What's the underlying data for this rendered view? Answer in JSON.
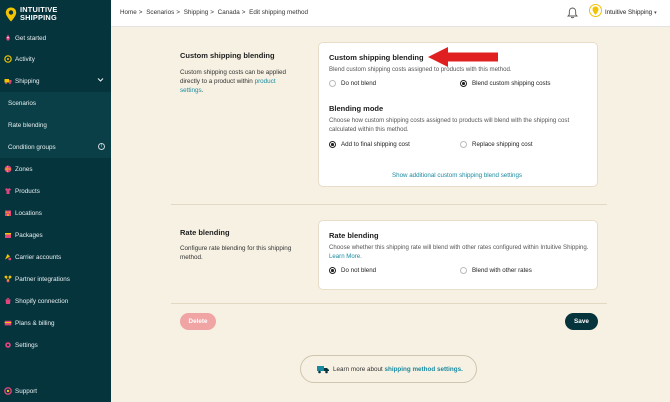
{
  "app": {
    "brand_line1": "INTUITIVE",
    "brand_line2": "SHIPPING"
  },
  "sidebar": {
    "items": [
      {
        "label": "Get started",
        "icon": "rocket-icon"
      },
      {
        "label": "Activity",
        "icon": "activity-icon"
      },
      {
        "label": "Shipping",
        "icon": "truck-icon"
      },
      {
        "label": "Scenarios"
      },
      {
        "label": "Rate blending"
      },
      {
        "label": "Condition groups"
      },
      {
        "label": "Zones",
        "icon": "globe-icon"
      },
      {
        "label": "Products",
        "icon": "shirt-icon"
      },
      {
        "label": "Locations",
        "icon": "building-icon"
      },
      {
        "label": "Packages",
        "icon": "box-icon"
      },
      {
        "label": "Carrier accounts",
        "icon": "carrier-icon"
      },
      {
        "label": "Partner integrations",
        "icon": "integration-icon"
      },
      {
        "label": "Shopify connection",
        "icon": "shopify-icon"
      },
      {
        "label": "Plans & billing",
        "icon": "billing-icon"
      },
      {
        "label": "Settings",
        "icon": "gear-icon"
      }
    ],
    "support": "Support"
  },
  "header": {
    "breadcrumbs": [
      "Home",
      "Scenarios",
      "Shipping",
      "Canada",
      "Edit shipping method"
    ],
    "separator": ">",
    "account_name": "Intuitive Shipping"
  },
  "custom_blending": {
    "section_title": "Custom shipping blending",
    "section_desc": "Custom shipping costs can be applied directly to a product within",
    "section_link": "product settings",
    "card_title": "Custom shipping blending",
    "card_desc": "Blend custom shipping costs assigned to products with this method.",
    "option_no": "Do not blend",
    "option_yes": "Blend custom shipping costs",
    "selected": "Blend custom shipping costs",
    "mode_title": "Blending mode",
    "mode_desc": "Choose how custom shipping costs assigned to products will blend with the shipping cost calculated within this method.",
    "mode_add": "Add to final shipping cost",
    "mode_replace": "Replace shipping cost",
    "mode_selected": "Add to final shipping cost",
    "show_more": "Show additional custom shipping blend settings"
  },
  "rate_blending": {
    "section_title": "Rate blending",
    "section_desc": "Configure rate blending for this shipping method.",
    "card_title": "Rate blending",
    "card_desc": "Choose whether this shipping rate will blend with other rates configured within Intuitive Shipping.",
    "card_link": "Learn More.",
    "option_no": "Do not blend",
    "option_yes": "Blend with other rates",
    "selected": "Do not blend"
  },
  "actions": {
    "delete": "Delete",
    "save": "Save"
  },
  "learn_more": {
    "text": "Learn more about",
    "link": "shipping method settings."
  },
  "colors": {
    "sidebar": "#06343d",
    "accent": "#1a8aa0",
    "background": "#f7f1e3",
    "delete": "#f0a4a4",
    "arrow": "#e02020",
    "logo_yellow": "#f2c300",
    "logo_pink": "#e0457b"
  }
}
